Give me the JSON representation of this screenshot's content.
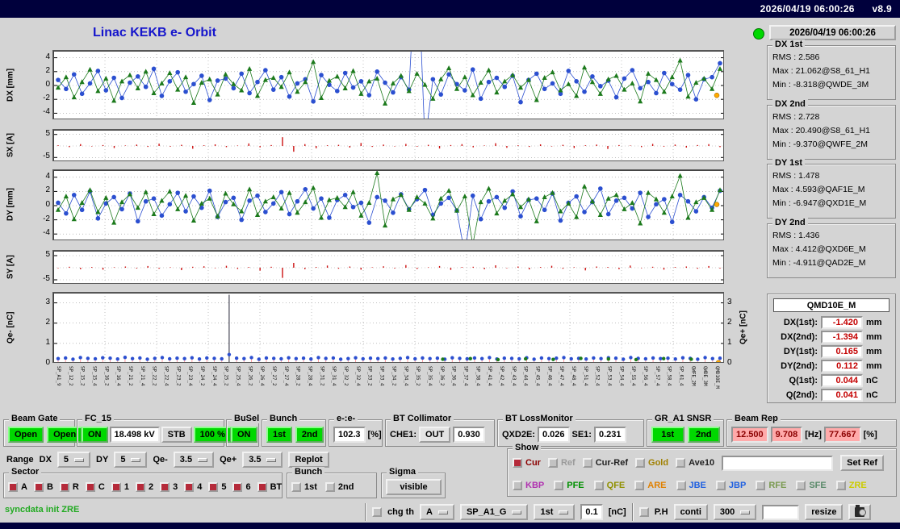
{
  "titlebar": {
    "datetime": "2026/04/19 06:00:26",
    "version": "v8.9"
  },
  "header": {
    "title": "Linac KEKB e- Orbit",
    "timestamp": "2026/04/19 06:00:26"
  },
  "stats_panels": [
    {
      "title": "DX 1st",
      "lines": [
        "RMS : 2.586",
        "Max : 21.062@S8_61_H1",
        "Min : -8.318@QWDE_3M"
      ]
    },
    {
      "title": "DX 2nd",
      "lines": [
        "RMS : 2.728",
        "Max : 20.490@S8_61_H1",
        "Min : -9.370@QWFE_2M"
      ]
    },
    {
      "title": "DY 1st",
      "lines": [
        "RMS : 1.478",
        "Max : 4.593@QAF1E_M",
        "Min : -6.947@QXD1E_M"
      ]
    },
    {
      "title": "DY 2nd",
      "lines": [
        "RMS : 1.436",
        "Max : 4.412@QXD6E_M",
        "Min : -4.911@QAD2E_M"
      ]
    }
  ],
  "qmd_panel": {
    "title": "QMD10E_M",
    "rows": [
      {
        "label": "DX(1st):",
        "value": "-1.420",
        "unit": "mm"
      },
      {
        "label": "DX(2nd):",
        "value": "-1.394",
        "unit": "mm"
      },
      {
        "label": "DY(1st):",
        "value": "0.165",
        "unit": "mm"
      },
      {
        "label": "DY(2nd):",
        "value": "0.112",
        "unit": "mm"
      },
      {
        "label": "Q(1st):",
        "value": "0.044",
        "unit": "nC"
      },
      {
        "label": "Q(2nd):",
        "value": "0.041",
        "unit": "nC"
      }
    ]
  },
  "row1": {
    "beam_gate": {
      "label": "Beam Gate",
      "open1": "Open",
      "open2": "Open"
    },
    "fc15": {
      "label": "FC_15",
      "on": "ON",
      "kv": "18.498 kV",
      "stb": "STB",
      "pct": "100 %"
    },
    "busel": {
      "label": "BuSel",
      "on": "ON"
    },
    "bunch": {
      "label": "Bunch",
      "b1": "1st",
      "b2": "2nd"
    },
    "ee": {
      "label": "e-:e-",
      "value": "102.3",
      "unit": "[%]"
    },
    "bt_collimator": {
      "label": "BT Collimator",
      "che1_label": "CHE1:",
      "che1_state": "OUT",
      "value": "0.930"
    },
    "bt_lossmonitor": {
      "label": "BT LossMonitor",
      "qxd2e_label": "QXD2E:",
      "qxd2e": "0.026",
      "se1_label": "SE1:",
      "se1": "0.231"
    },
    "gr_snsr": {
      "label": "GR_A1 SNSR",
      "b1": "1st",
      "b2": "2nd"
    },
    "beam_rep": {
      "label": "Beam Rep",
      "v1": "12.500",
      "v2": "9.708",
      "hz": "[Hz]",
      "v3": "77.667",
      "pct": "[%]"
    }
  },
  "row2": {
    "range": "Range",
    "dx_label": "DX",
    "dx": "5",
    "dy_label": "DY",
    "dy": "5",
    "qem_label": "Qe-",
    "qem": "3.5",
    "qep_label": "Qe+",
    "qep": "3.5",
    "replot": "Replot"
  },
  "show": {
    "label": "Show",
    "row1": [
      {
        "label": "Cur",
        "color": "#8b0000",
        "box": "#b52a3a"
      },
      {
        "label": "Ref",
        "color": "#9a9a9a",
        "box": "#c2c2c2"
      },
      {
        "label": "Cur-Ref",
        "color": "#222222",
        "box": "#c2c2c2"
      },
      {
        "label": "Gold",
        "color": "#a08000",
        "box": "#c2c2c2"
      },
      {
        "label": "Ave10",
        "color": "#222222",
        "box": "#c2c2c2"
      }
    ],
    "set_ref": "Set Ref",
    "row2": [
      {
        "label": "KBP",
        "color": "#b030b0",
        "box": "#c2c2c2"
      },
      {
        "label": "PFE",
        "color": "#009000",
        "box": "#c2c2c2"
      },
      {
        "label": "QFE",
        "color": "#909000",
        "box": "#c2c2c2"
      },
      {
        "label": "ARE",
        "color": "#e08000",
        "box": "#c2c2c2"
      },
      {
        "label": "JBE",
        "color": "#2060e0",
        "box": "#c2c2c2"
      },
      {
        "label": "JBP",
        "color": "#2060e0",
        "box": "#c2c2c2"
      },
      {
        "label": "RFE",
        "color": "#7a9a50",
        "box": "#c2c2c2"
      },
      {
        "label": "SFE",
        "color": "#5a8a6a",
        "box": "#c2c2c2"
      },
      {
        "label": "ZRE",
        "color": "#cccc00",
        "box": "#c2c2c2"
      }
    ]
  },
  "sector": {
    "label": "Sector",
    "items": [
      "A",
      "B",
      "R",
      "C",
      "1",
      "2",
      "3",
      "4",
      "5",
      "6",
      "BT"
    ]
  },
  "bunch3": {
    "label": "Bunch",
    "items": [
      "1st",
      "2nd"
    ]
  },
  "sigma": {
    "label": "Sigma",
    "button": "visible"
  },
  "row4": {
    "status": "syncdata init ZRE",
    "chg_th": "chg th",
    "opt_a": "A",
    "opt_sp": "SP_A1_G",
    "opt_1st": "1st",
    "th_value": "0.1",
    "th_unit": "[nC]",
    "ph": "P.H",
    "conti": "conti",
    "opt_300": "300",
    "resize": "resize"
  },
  "monitor_labels": [
    "SP_A1_9",
    "SP_12_2",
    "SP_15_2",
    "SP_15_4",
    "SP_16_2",
    "SP_16_4",
    "SP_21_2",
    "SP_21_4",
    "SP_22_2",
    "SP_22_4",
    "SP_23_2",
    "SP_23_4",
    "SP_24_2",
    "SP_24_4",
    "SP_25_2",
    "SP_25_4",
    "SP_26_2",
    "SP_26_4",
    "SP_27_2",
    "SP_27_4",
    "SP_28_2",
    "SP_28_4",
    "SP_31_2",
    "SP_31_4",
    "SP_32_2",
    "SP_32_4",
    "SP_33_2",
    "SP_33_4",
    "SP_34_2",
    "SP_34_4",
    "SP_35_2",
    "SP_35_4",
    "SP_36_2",
    "SP_36_4",
    "SP_37_4",
    "SP_38_4",
    "SP_41_4",
    "SP_42_4",
    "SP_43_4",
    "SP_44_4",
    "SP_45_4",
    "SP_46_4",
    "SP_47_4",
    "SP_48_4",
    "SP_51_4",
    "SP_52_4",
    "SP_53_4",
    "SP_54_4",
    "SP_55_4",
    "SP_56_4",
    "SP_57_4",
    "SP_58_4",
    "SP_61_4",
    "QWFE_2M",
    "QWDE_3M",
    "QMD10E_M"
  ],
  "chart_data": [
    {
      "type": "scatter",
      "ylabel": "DX [mm]",
      "yticks": [
        4,
        2,
        0,
        -2,
        -4
      ],
      "ylim": [
        -5,
        5
      ],
      "series": [
        {
          "name": "1st bunch",
          "color": "#2b4fd0",
          "marker": "circle",
          "values": [
            0.8,
            -0.5,
            1.6,
            -1.2,
            0.3,
            2.1,
            -0.7,
            1.1,
            -1.8,
            0.4,
            1.3,
            -0.2,
            2.4,
            -1.5,
            0.6,
            1.9,
            -0.9,
            0.2,
            1.4,
            -2.1,
            0.7,
            1.0,
            -0.4,
            1.7,
            -1.1,
            0.5,
            2.2,
            -0.6,
            1.2,
            -1.6,
            0.3,
            0.9,
            -2.3,
            1.5,
            0.1,
            -0.8,
            1.8,
            -0.3,
            0.6,
            -1.4,
            2.0,
            0.4,
            -1.0,
            1.2,
            -0.6,
            21.0,
            -8.3,
            0.9,
            -1.3,
            1.6,
            0.2,
            -0.7,
            2.3,
            -1.9,
            0.5,
            1.1,
            -0.2,
            1.4,
            -2.4,
            0.8,
            1.7,
            -0.5,
            0.3,
            -1.2,
            2.1,
            0.6,
            -0.9,
            1.3,
            -0.1,
            0.7,
            -1.7,
            1.0,
            2.2,
            -0.4,
            0.5,
            -1.1,
            1.8,
            0.2,
            -0.6,
            1.5,
            -2.0,
            0.9,
            1.2,
            3.2
          ]
        },
        {
          "name": "2nd bunch",
          "color": "#1c7a1c",
          "marker": "triangle",
          "values": [
            -0.3,
            1.2,
            -1.7,
            0.5,
            2.3,
            -0.8,
            1.0,
            -2.2,
            0.6,
            1.5,
            -0.4,
            2.0,
            -1.1,
            0.3,
            1.8,
            -0.6,
            1.2,
            -2.5,
            0.4,
            0.9,
            -1.3,
            1.6,
            0.2,
            -0.7,
            2.4,
            -1.5,
            0.8,
            1.1,
            -0.2,
            1.9,
            -0.9,
            0.5,
            3.4,
            -1.8,
            0.7,
            1.3,
            -0.4,
            2.1,
            -1.2,
            0.6,
            1.0,
            -2.6,
            0.3,
            1.4,
            -0.8,
            1.7,
            0.1,
            -1.9,
            0.9,
            2.5,
            -0.5,
            1.2,
            -1.4,
            0.4,
            2.2,
            -1.0,
            0.6,
            1.5,
            -0.3,
            0.8,
            -2.1,
            1.1,
            1.9,
            -0.7,
            0.2,
            -1.5,
            2.6,
            0.5,
            -1.2,
            0.9,
            1.4,
            -0.6,
            0.3,
            -2.3,
            1.7,
            0.8,
            -0.9,
            1.2,
            3.6,
            -1.6,
            0.4,
            1.0,
            -0.5,
            2.4
          ]
        }
      ],
      "marker_point": {
        "value": -1.42,
        "color": "#ffaa00"
      }
    },
    {
      "type": "bar",
      "ylabel": "SX [A]",
      "yticks": [
        5,
        -5
      ],
      "grid_extra": [
        0
      ],
      "ylim": [
        -7,
        7
      ],
      "bar_color": "#cc1111",
      "values": [
        0.3,
        -0.5,
        0.8,
        -0.2,
        0.4,
        -0.9,
        0.2,
        0.6,
        -0.4,
        1.0,
        -0.3,
        0.5,
        -1.2,
        0.3,
        0.7,
        -0.5,
        0.2,
        1.1,
        -0.6,
        0.4,
        3.8,
        -2.5,
        0.8,
        -1.0,
        0.3,
        0.5,
        -0.7,
        1.3,
        -0.4,
        0.6,
        -0.2,
        0.9,
        -0.3,
        0.5,
        -1.1,
        0.4,
        0.8,
        -0.6,
        0.2,
        1.2,
        -0.8,
        0.3,
        -0.4,
        0.7,
        -0.2,
        0.5,
        -0.9,
        0.3,
        0.6,
        -1.3,
        0.4,
        0.2,
        -0.5,
        0.9,
        -0.3,
        0.6,
        -0.7,
        0.4,
        0.8,
        -0.5
      ]
    },
    {
      "type": "scatter",
      "ylabel": "DY [mm]",
      "yticks": [
        4,
        2,
        0,
        -2,
        -4
      ],
      "ylim": [
        -5,
        5
      ],
      "series": [
        {
          "name": "1st bunch",
          "color": "#2b4fd0",
          "marker": "circle",
          "values": [
            0.4,
            -1.1,
            1.5,
            -0.6,
            2.0,
            -1.8,
            0.3,
            1.2,
            -0.5,
            1.7,
            -2.2,
            0.6,
            1.0,
            -1.4,
            0.2,
            1.8,
            -0.8,
            1.3,
            -0.3,
            2.1,
            -1.6,
            0.5,
            1.1,
            -2.0,
            0.7,
            1.4,
            -0.9,
            0.3,
            1.9,
            -1.2,
            0.6,
            2.3,
            -0.4,
            1.0,
            -1.7,
            0.8,
            1.5,
            -0.2,
            0.4,
            -2.4,
            1.2,
            0.7,
            -1.0,
            1.6,
            -0.5,
            0.9,
            2.2,
            -1.3,
            0.3,
            1.1,
            -0.7,
            -6.9,
            1.4,
            -1.9,
            0.6,
            1.2,
            -0.3,
            2.0,
            -1.5,
            0.8,
            1.0,
            -0.6,
            1.7,
            -2.1,
            0.4,
            1.3,
            -0.9,
            0.5,
            2.4,
            -1.2,
            0.7,
            1.1,
            -0.4,
            1.8,
            -1.6,
            0.2,
            0.9,
            -2.3,
            1.5,
            0.6,
            -0.8,
            1.2,
            -0.3,
            2.1
          ]
        },
        {
          "name": "2nd bunch",
          "color": "#1c7a1c",
          "marker": "triangle",
          "values": [
            -0.6,
            1.3,
            -1.9,
            0.4,
            2.2,
            -0.9,
            1.1,
            -2.4,
            0.5,
            1.6,
            -0.3,
            1.9,
            -1.2,
            0.7,
            2.0,
            -0.5,
            1.4,
            -2.1,
            0.3,
            1.0,
            -1.5,
            1.7,
            0.2,
            -0.8,
            2.3,
            -1.3,
            0.6,
            1.2,
            -0.4,
            1.8,
            -1.0,
            0.5,
            2.5,
            -1.7,
            0.8,
            1.1,
            -0.2,
            1.9,
            -1.4,
            0.4,
            4.6,
            -2.8,
            0.9,
            1.5,
            -0.6,
            1.2,
            0.3,
            -1.8,
            1.0,
            2.1,
            -0.7,
            1.3,
            -5.5,
            0.5,
            2.4,
            -1.1,
            0.7,
            1.6,
            -0.2,
            0.9,
            -2.2,
            1.2,
            1.8,
            -0.8,
            0.3,
            -1.6,
            2.7,
            0.6,
            -1.3,
            1.0,
            1.5,
            -0.5,
            0.4,
            -2.5,
            1.8,
            0.9,
            -1.0,
            1.3,
            4.2,
            -1.7,
            0.5,
            1.1,
            -0.6,
            2.2
          ]
        }
      ],
      "marker_point": {
        "value": 0.17,
        "color": "#ffaa00"
      }
    },
    {
      "type": "bar",
      "ylabel": "SY [A]",
      "yticks": [
        5,
        -5
      ],
      "grid_extra": [
        0
      ],
      "ylim": [
        -7,
        7
      ],
      "bar_color": "#cc1111",
      "values": [
        -0.2,
        0.4,
        -0.6,
        0.3,
        -0.8,
        0.2,
        0.5,
        -0.3,
        0.7,
        -0.4,
        0.2,
        -1.0,
        0.4,
        0.6,
        -0.2,
        0.8,
        -0.5,
        0.3,
        -1.2,
        0.4,
        -4.2,
        2.0,
        -0.6,
        0.3,
        0.9,
        -0.4,
        0.5,
        -0.8,
        0.2,
        0.6,
        -0.3,
        1.1,
        -0.5,
        0.2,
        0.7,
        -0.9,
        0.3,
        0.4,
        -0.6,
        1.0,
        -0.2,
        0.5,
        -0.7,
        0.3,
        0.8,
        -0.4,
        0.2,
        -1.1,
        0.5,
        0.3,
        -0.6,
        0.9,
        -0.2,
        0.4,
        -0.8,
        0.3,
        0.5,
        -0.4,
        0.7,
        -0.3
      ]
    },
    {
      "type": "charge",
      "ylabel": "Qe- [nC]",
      "ylabel_right": "Qe+ [nC]",
      "yticks": [
        3,
        2,
        1,
        0
      ],
      "ylim": [
        0,
        3.5
      ],
      "impulse_color": "#ff9aa0",
      "series": [
        {
          "name": "Qe-",
          "color": "#2b4fd0",
          "values": [
            0.25,
            0.28,
            0.22,
            0.3,
            0.26,
            0.24,
            0.29,
            0.27,
            0.23,
            0.31,
            0.25,
            0.28,
            0.22,
            0.26,
            0.3,
            0.24,
            0.27,
            0.25,
            0.29,
            0.23,
            0.28,
            0.26,
            0.24,
            3.4,
            0.27,
            0.25,
            0.3,
            0.22,
            0.28,
            0.26,
            0.24,
            0.29,
            0.25,
            0.27,
            0.23,
            0.3,
            0.26,
            0.28,
            0.22,
            0.25,
            0.29,
            0.24,
            0.27,
            0.25,
            0.28,
            0.23,
            0.26,
            0.3,
            0.24,
            0.28,
            0.25,
            0.27,
            0.22,
            0.29,
            0.26,
            0.24,
            0.28,
            0.25,
            0.3,
            0.23,
            0.27,
            0.26,
            0.24,
            0.29,
            0.22,
            0.28,
            0.25,
            0.27,
            0.3,
            0.24,
            0.26,
            0.23,
            0.28,
            0.25,
            0.29,
            0.27,
            0.22,
            0.3,
            0.26,
            0.24,
            0.28,
            0.25,
            0.27,
            0.23,
            0.29,
            0.26,
            0.22,
            0.3,
            0.25,
            0.27
          ]
        },
        {
          "name": "Qe+",
          "color": "#1c7a1c",
          "x_range": [
            0.58,
            0.95
          ],
          "values": [
            0.22,
            0.25,
            0.2,
            0.24,
            0.21,
            0.26,
            0.23,
            0.2,
            0.25,
            0.22
          ]
        }
      ],
      "marker_point": {
        "value": 0.05,
        "color": "#ffaa00"
      }
    }
  ]
}
